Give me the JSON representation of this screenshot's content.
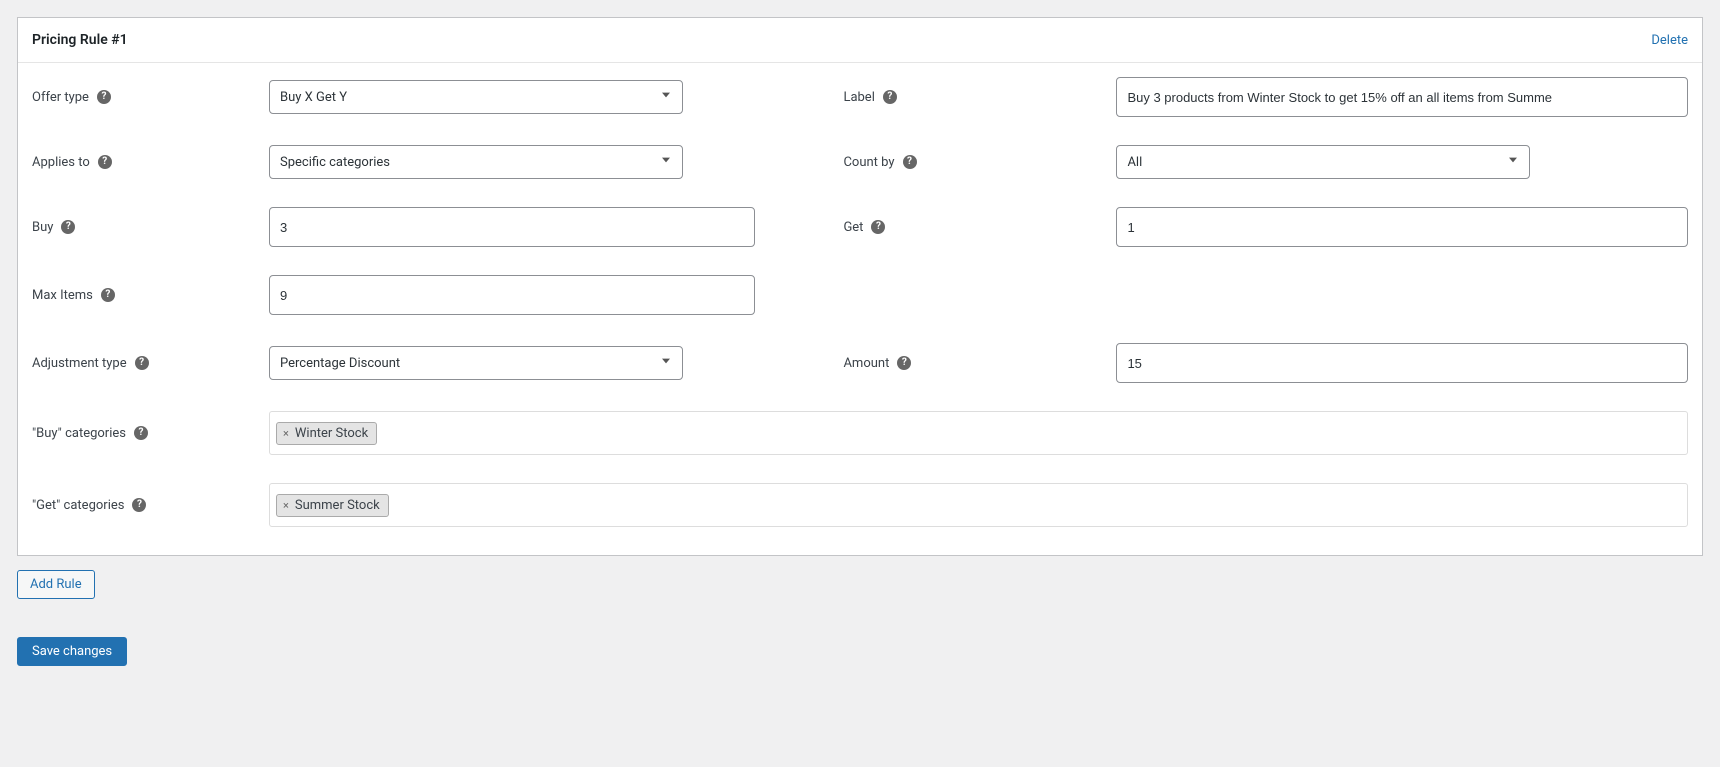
{
  "panel": {
    "title": "Pricing Rule #1",
    "delete_label": "Delete"
  },
  "labels": {
    "offer_type": "Offer type",
    "label": "Label",
    "applies_to": "Applies to",
    "count_by": "Count by",
    "buy": "Buy",
    "get": "Get",
    "max_items": "Max Items",
    "adjustment_type": "Adjustment type",
    "amount": "Amount",
    "buy_categories": "\"Buy\" categories",
    "get_categories": "\"Get\" categories"
  },
  "fields": {
    "offer_type": "Buy X Get Y",
    "label_value": "Buy 3 products from Winter Stock to get 15% off an all items from Summe",
    "applies_to": "Specific categories",
    "count_by": "All",
    "buy": "3",
    "get": "1",
    "max_items": "9",
    "adjustment_type": "Percentage Discount",
    "amount": "15",
    "buy_category_tag": "Winter Stock",
    "get_category_tag": "Summer Stock"
  },
  "buttons": {
    "add_rule": "Add Rule",
    "save": "Save changes"
  }
}
